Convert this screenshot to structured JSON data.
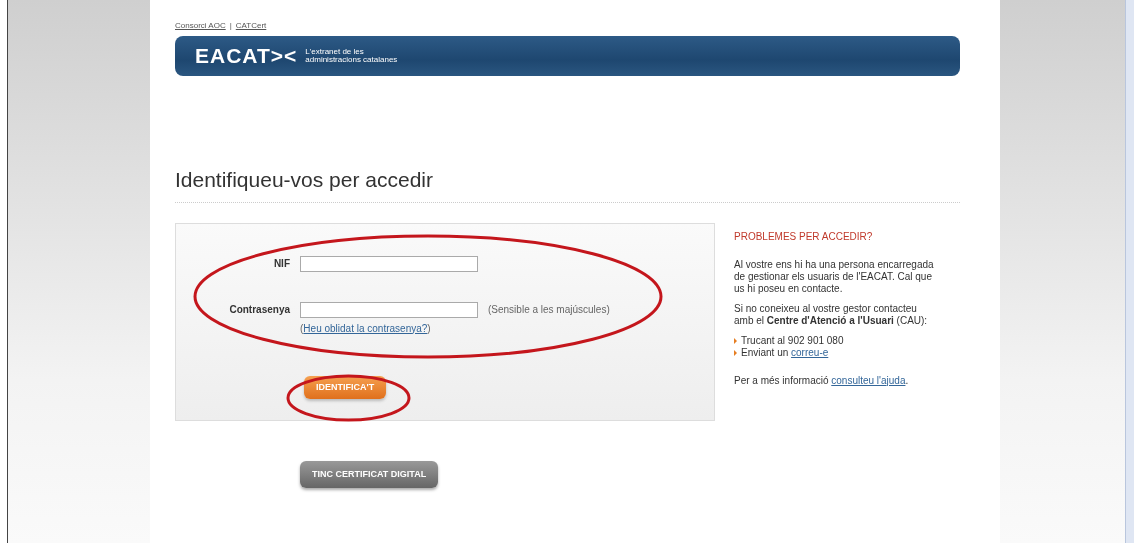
{
  "top_links": [
    {
      "label": "Consorci AOC"
    },
    {
      "label": "CATCert"
    }
  ],
  "top_links_separator": "|",
  "banner": {
    "logo": "EACAT><",
    "tagline_1": "L'extranet de les",
    "tagline_2": "administracions catalanes"
  },
  "heading": "Identifiqueu-vos per accedir",
  "login_form": {
    "circled": true,
    "fields": [
      {
        "label": "NIF"
      },
      {
        "label": "Contrasenya",
        "hint": "(Sensible a les majúscules)",
        "link_open": "(",
        "link": "Heu oblidat la contrasenya?",
        "link_close": ")"
      }
    ],
    "submit_button": {
      "label": "IDENTIFICA'T",
      "circled": true
    }
  },
  "certificate_button": {
    "label": "TINC CERTIFICAT DIGITAL"
  },
  "help": {
    "title": "PROBLEMES PER ACCEDIR?",
    "paragraph_1": "Al vostre ens hi ha una persona encarregada de gestionar els usuaris de l'EACAT. Cal que us hi poseu en contacte.",
    "paragraph_2": "Si no coneixeu al vostre gestor contacteu amb el **Centre d'Atenció a l'Usuari** (CAU):",
    "options": [
      {
        "text": "Trucant al 902 901 080"
      },
      {
        "text": "Enviant un ",
        "link": "correu-e"
      }
    ],
    "more_text": "Per a més informació ",
    "more_link": "consulteu l'ajuda",
    "more_end": "."
  }
}
